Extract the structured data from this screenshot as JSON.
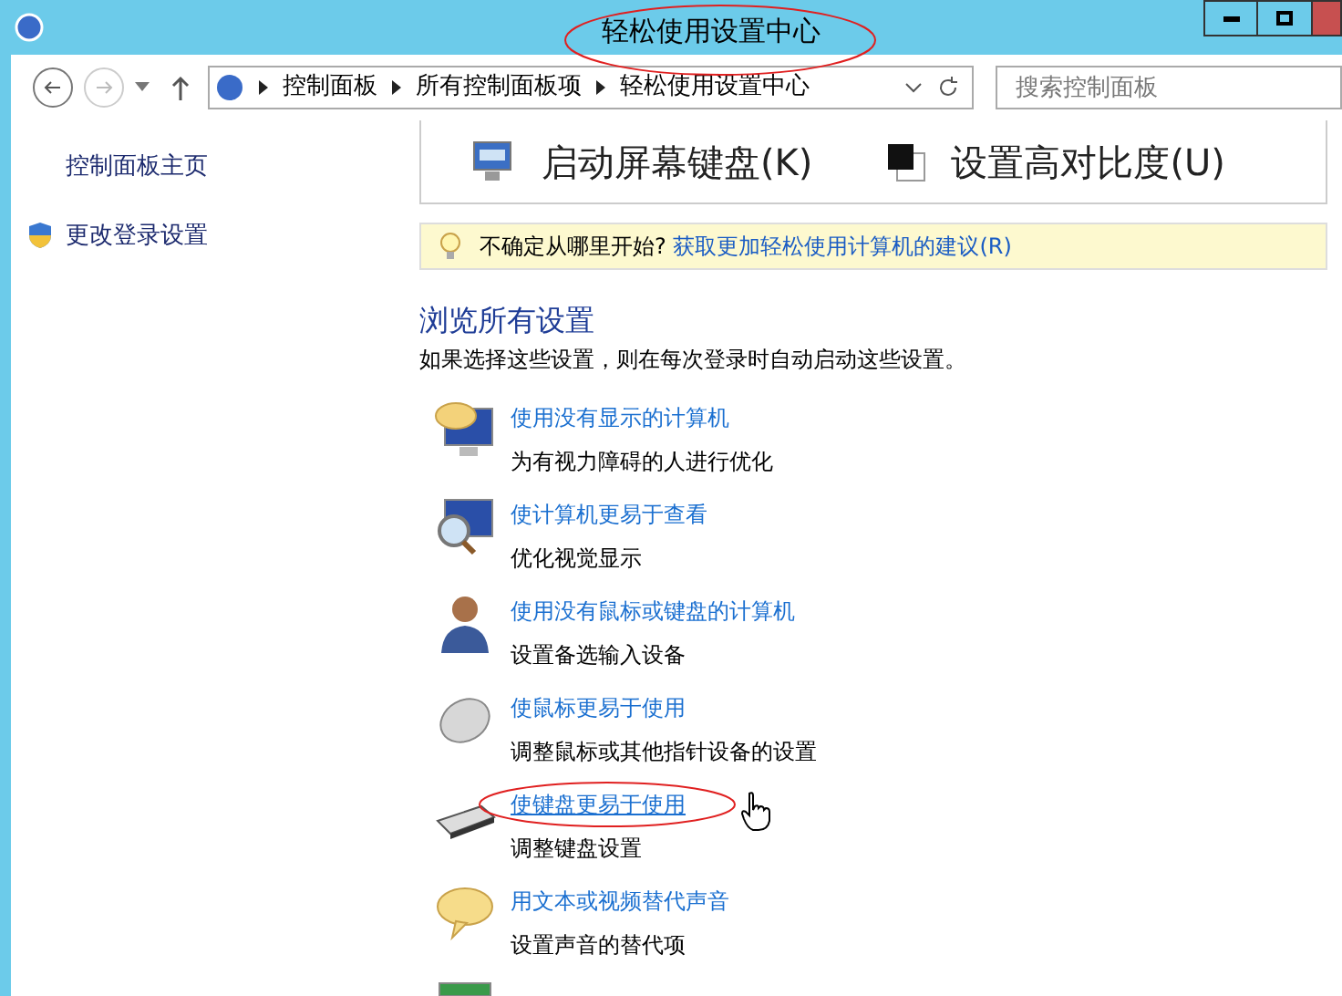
{
  "window": {
    "title": "轻松使用设置中心"
  },
  "breadcrumb": [
    "控制面板",
    "所有控制面板项",
    "轻松使用设置中心"
  ],
  "search": {
    "placeholder": "搜索控制面板"
  },
  "sidebar": {
    "items": [
      {
        "label": "控制面板主页",
        "kind": "plain"
      },
      {
        "label": "更改登录设置",
        "kind": "shield"
      }
    ]
  },
  "quick_actions": [
    {
      "label": "启动屏幕键盘(K)",
      "kind": "keyboard"
    },
    {
      "label": "设置高对比度(U)",
      "kind": "contrast"
    }
  ],
  "tip": {
    "text": "不确定从哪里开始?",
    "link": "获取更加轻松使用计算机的建议(R)"
  },
  "section": {
    "title": "浏览所有设置",
    "description": "如果选择这些设置，则在每次登录时自动启动这些设置。"
  },
  "settings": [
    {
      "title": "使用没有显示的计算机",
      "subtitle": "为有视力障碍的人进行优化",
      "kind": "monitor-speech",
      "hovered": false
    },
    {
      "title": "使计算机更易于查看",
      "subtitle": "优化视觉显示",
      "kind": "magnifier",
      "hovered": false
    },
    {
      "title": "使用没有鼠标或键盘的计算机",
      "subtitle": "设置备选输入设备",
      "kind": "person",
      "hovered": false
    },
    {
      "title": "使鼠标更易于使用",
      "subtitle": "调整鼠标或其他指针设备的设置",
      "kind": "mouse",
      "hovered": false
    },
    {
      "title": "使键盘更易于使用",
      "subtitle": "调整键盘设置",
      "kind": "keyboard",
      "hovered": true
    },
    {
      "title": "用文本或视频替代声音",
      "subtitle": "设置声音的替代项",
      "kind": "speech",
      "hovered": false
    }
  ]
}
